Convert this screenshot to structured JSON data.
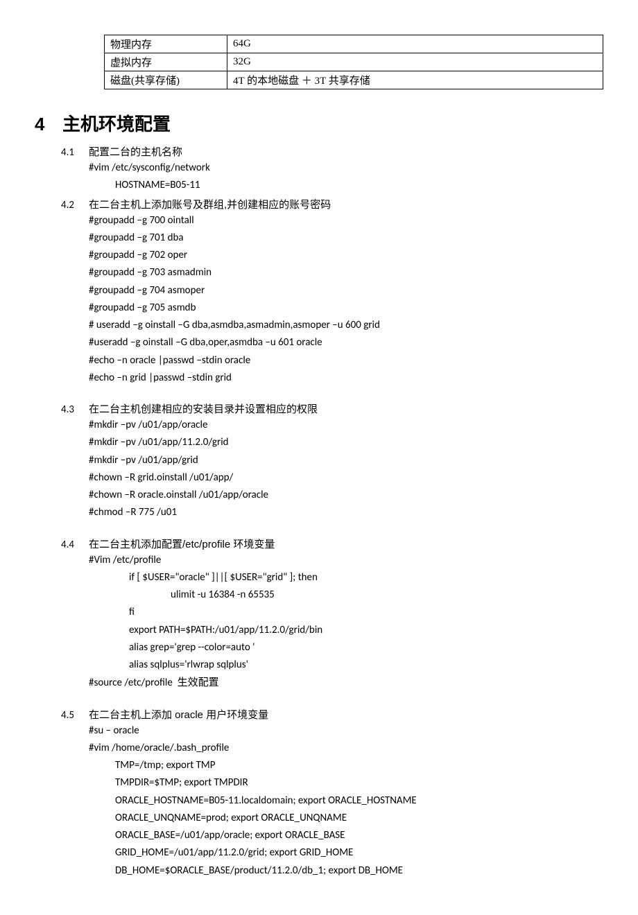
{
  "table": {
    "rows": [
      {
        "label": "物理内存",
        "value": "64G"
      },
      {
        "label": "虚拟内存",
        "value": "32G"
      },
      {
        "label": "磁盘(共享存储)",
        "value": "4T 的本地磁盘 ＋ 3T 共享存储"
      }
    ]
  },
  "section4": {
    "num": "4",
    "title": "主机环境配置",
    "s41": {
      "num": "4.1",
      "title": "配置二台的主机名称",
      "l1": "#vim /etc/sysconfig/network",
      "l2": "HOSTNAME=B05-11"
    },
    "s42": {
      "num": "4.2",
      "title": "在二台主机上添加账号及群组,并创建相应的账号密码",
      "lines": [
        "#groupadd –g 700 ointall",
        "#groupadd –g 701 dba",
        "#groupadd –g 702 oper",
        "#groupadd –g 703 asmadmin",
        "#groupadd –g 704 asmoper",
        "#groupadd –g 705 asmdb",
        "# useradd –g oinstall –G dba,asmdba,asmadmin,asmoper –u 600 grid",
        "#useradd –g oinstall –G dba,oper,asmdba –u 601 oracle",
        "#echo –n oracle |passwd –stdin oracle",
        "#echo –n grid |passwd –stdin grid"
      ]
    },
    "s43": {
      "num": "4.3",
      "title": "在二台主机创建相应的安装目录并设置相应的权限",
      "lines": [
        "#mkdir –pv /u01/app/oracle",
        "#mkdir –pv /u01/app/11.2.0/grid",
        "#mkdir –pv /u01/app/grid",
        "#chown –R grid.oinstall /u01/app/",
        "#chown –R oracle.oinstall /u01/app/oracle",
        "#chmod –R 775 /u01"
      ]
    },
    "s44": {
      "num": "4.4",
      "title": "在二台主机添加配置/etc/profile 环境变量",
      "l1": "#Vim /etc/profile",
      "l2": "if [ $USER=\"oracle\" ]||[ $USER=\"grid\" ]; then",
      "l3": "ulimit -u 16384 -n 65535",
      "l4": "fi",
      "l5": "export PATH=$PATH:/u01/app/11.2.0/grid/bin",
      "l6": "alias grep='grep --color=auto '",
      "l7": "alias sqlplus='rlwrap sqlplus'",
      "l8a": "#source /etc/profile",
      "l8b": "生效配置"
    },
    "s45": {
      "num": "4.5",
      "title": "在二台主机上添加 oracle 用户环境变量",
      "l1": "#su – oracle",
      "l2": "#vim /home/oracle/.bash_profile",
      "lines": [
        "TMP=/tmp; export TMP",
        "TMPDIR=$TMP; export TMPDIR",
        "ORACLE_HOSTNAME=B05-11.localdomain; export ORACLE_HOSTNAME",
        "ORACLE_UNQNAME=prod; export ORACLE_UNQNAME",
        "ORACLE_BASE=/u01/app/oracle; export ORACLE_BASE",
        "GRID_HOME=/u01/app/11.2.0/grid; export GRID_HOME",
        "DB_HOME=$ORACLE_BASE/product/11.2.0/db_1; export DB_HOME"
      ]
    }
  }
}
